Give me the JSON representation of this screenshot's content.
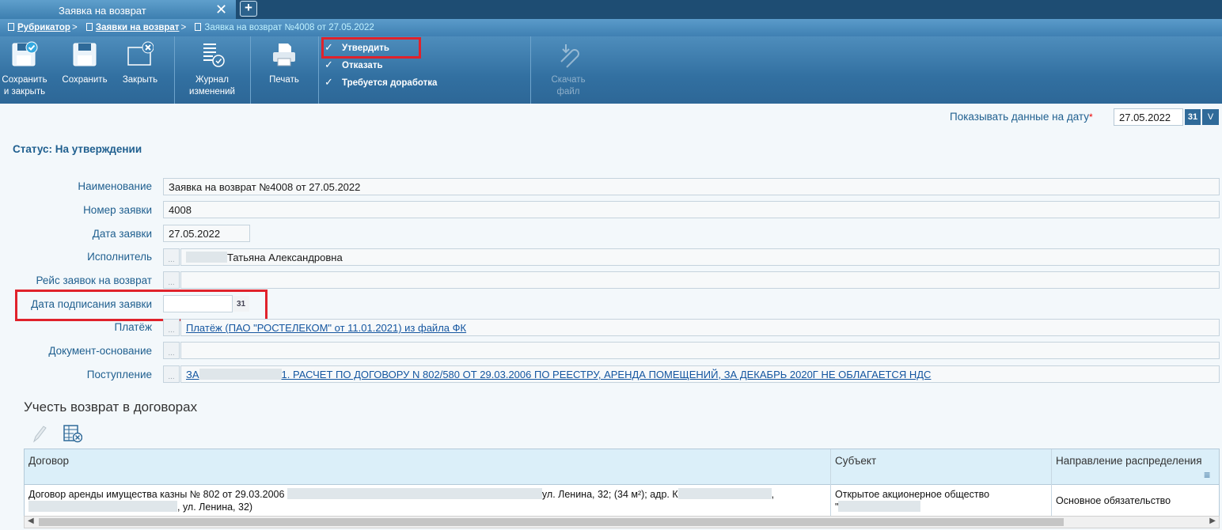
{
  "tabs": {
    "active": "Заявка на возврат",
    "add": "+",
    "close": "✕"
  },
  "breadcrumb": {
    "item1": "Рубрикатор",
    "item2": "Заявки на возврат",
    "current": "Заявка на возврат №4008 от 27.05.2022",
    "sep": ">"
  },
  "toolbar": {
    "save_close": [
      "Сохранить",
      "и закрыть"
    ],
    "save": "Сохранить",
    "close": "Закрыть",
    "journal": [
      "Журнал",
      "изменений"
    ],
    "print": "Печать",
    "approve": "Утвердить",
    "reject": "Отказать",
    "rework": "Требуется доработка",
    "download": [
      "Скачать",
      "файл"
    ],
    "check": "✓"
  },
  "date_filter": {
    "label": "Показывать данные на дату",
    "required": "*",
    "value": "27.05.2022",
    "cal": "31",
    "dd": "V"
  },
  "status": "Статус: На утверждении",
  "form": {
    "name_label": "Наименование",
    "name_value": "Заявка на возврат №4008 от 27.05.2022",
    "number_label": "Номер заявки",
    "number_value": "4008",
    "date_label": "Дата заявки",
    "date_value": "27.05.2022",
    "executor_label": "Исполнитель",
    "executor_value": "Татьяна Александровна",
    "reys_label": "Рейс заявок на возврат",
    "sign_date_label": "Дата подписания заявки",
    "payment_label": "Платёж",
    "payment_value": "Платёж (ПАО \"РОСТЕЛЕКОМ\" от 11.01.2021) из файла ФК",
    "doc_label": "Документ-основание",
    "income_label": "Поступление",
    "income_prefix": "ЗА",
    "income_value": "1. РАСЧЕТ ПО ДОГОВОРУ N 802/580 ОТ 29.03.2006 ПО РЕЕСТРУ, АРЕНДА ПОМЕЩЕНИЙ, ЗА ДЕКАБРЬ 2020Г НЕ ОБЛАГАЕТСЯ НДС",
    "dots": "..."
  },
  "contracts": {
    "title": "Учесть возврат в договорах",
    "columns": [
      "Договор",
      "Субъект",
      "Направление распределения"
    ],
    "menu_icon": "≡",
    "row": {
      "contract_a": "Договор аренды имущества казны № 802 от 29.03.2006",
      "contract_b": "ул. Ленина, 32; (34 м²); адр. К",
      "contract_c": ", ул. Ленина, 32)",
      "subject": "Открытое акционерное общество",
      "subject_b": "\"",
      "direction": "Основное обязательство"
    }
  },
  "colors": {
    "accent": "#1f5f8f",
    "highlight": "#e0222b",
    "toolbar": "#3270a1"
  }
}
